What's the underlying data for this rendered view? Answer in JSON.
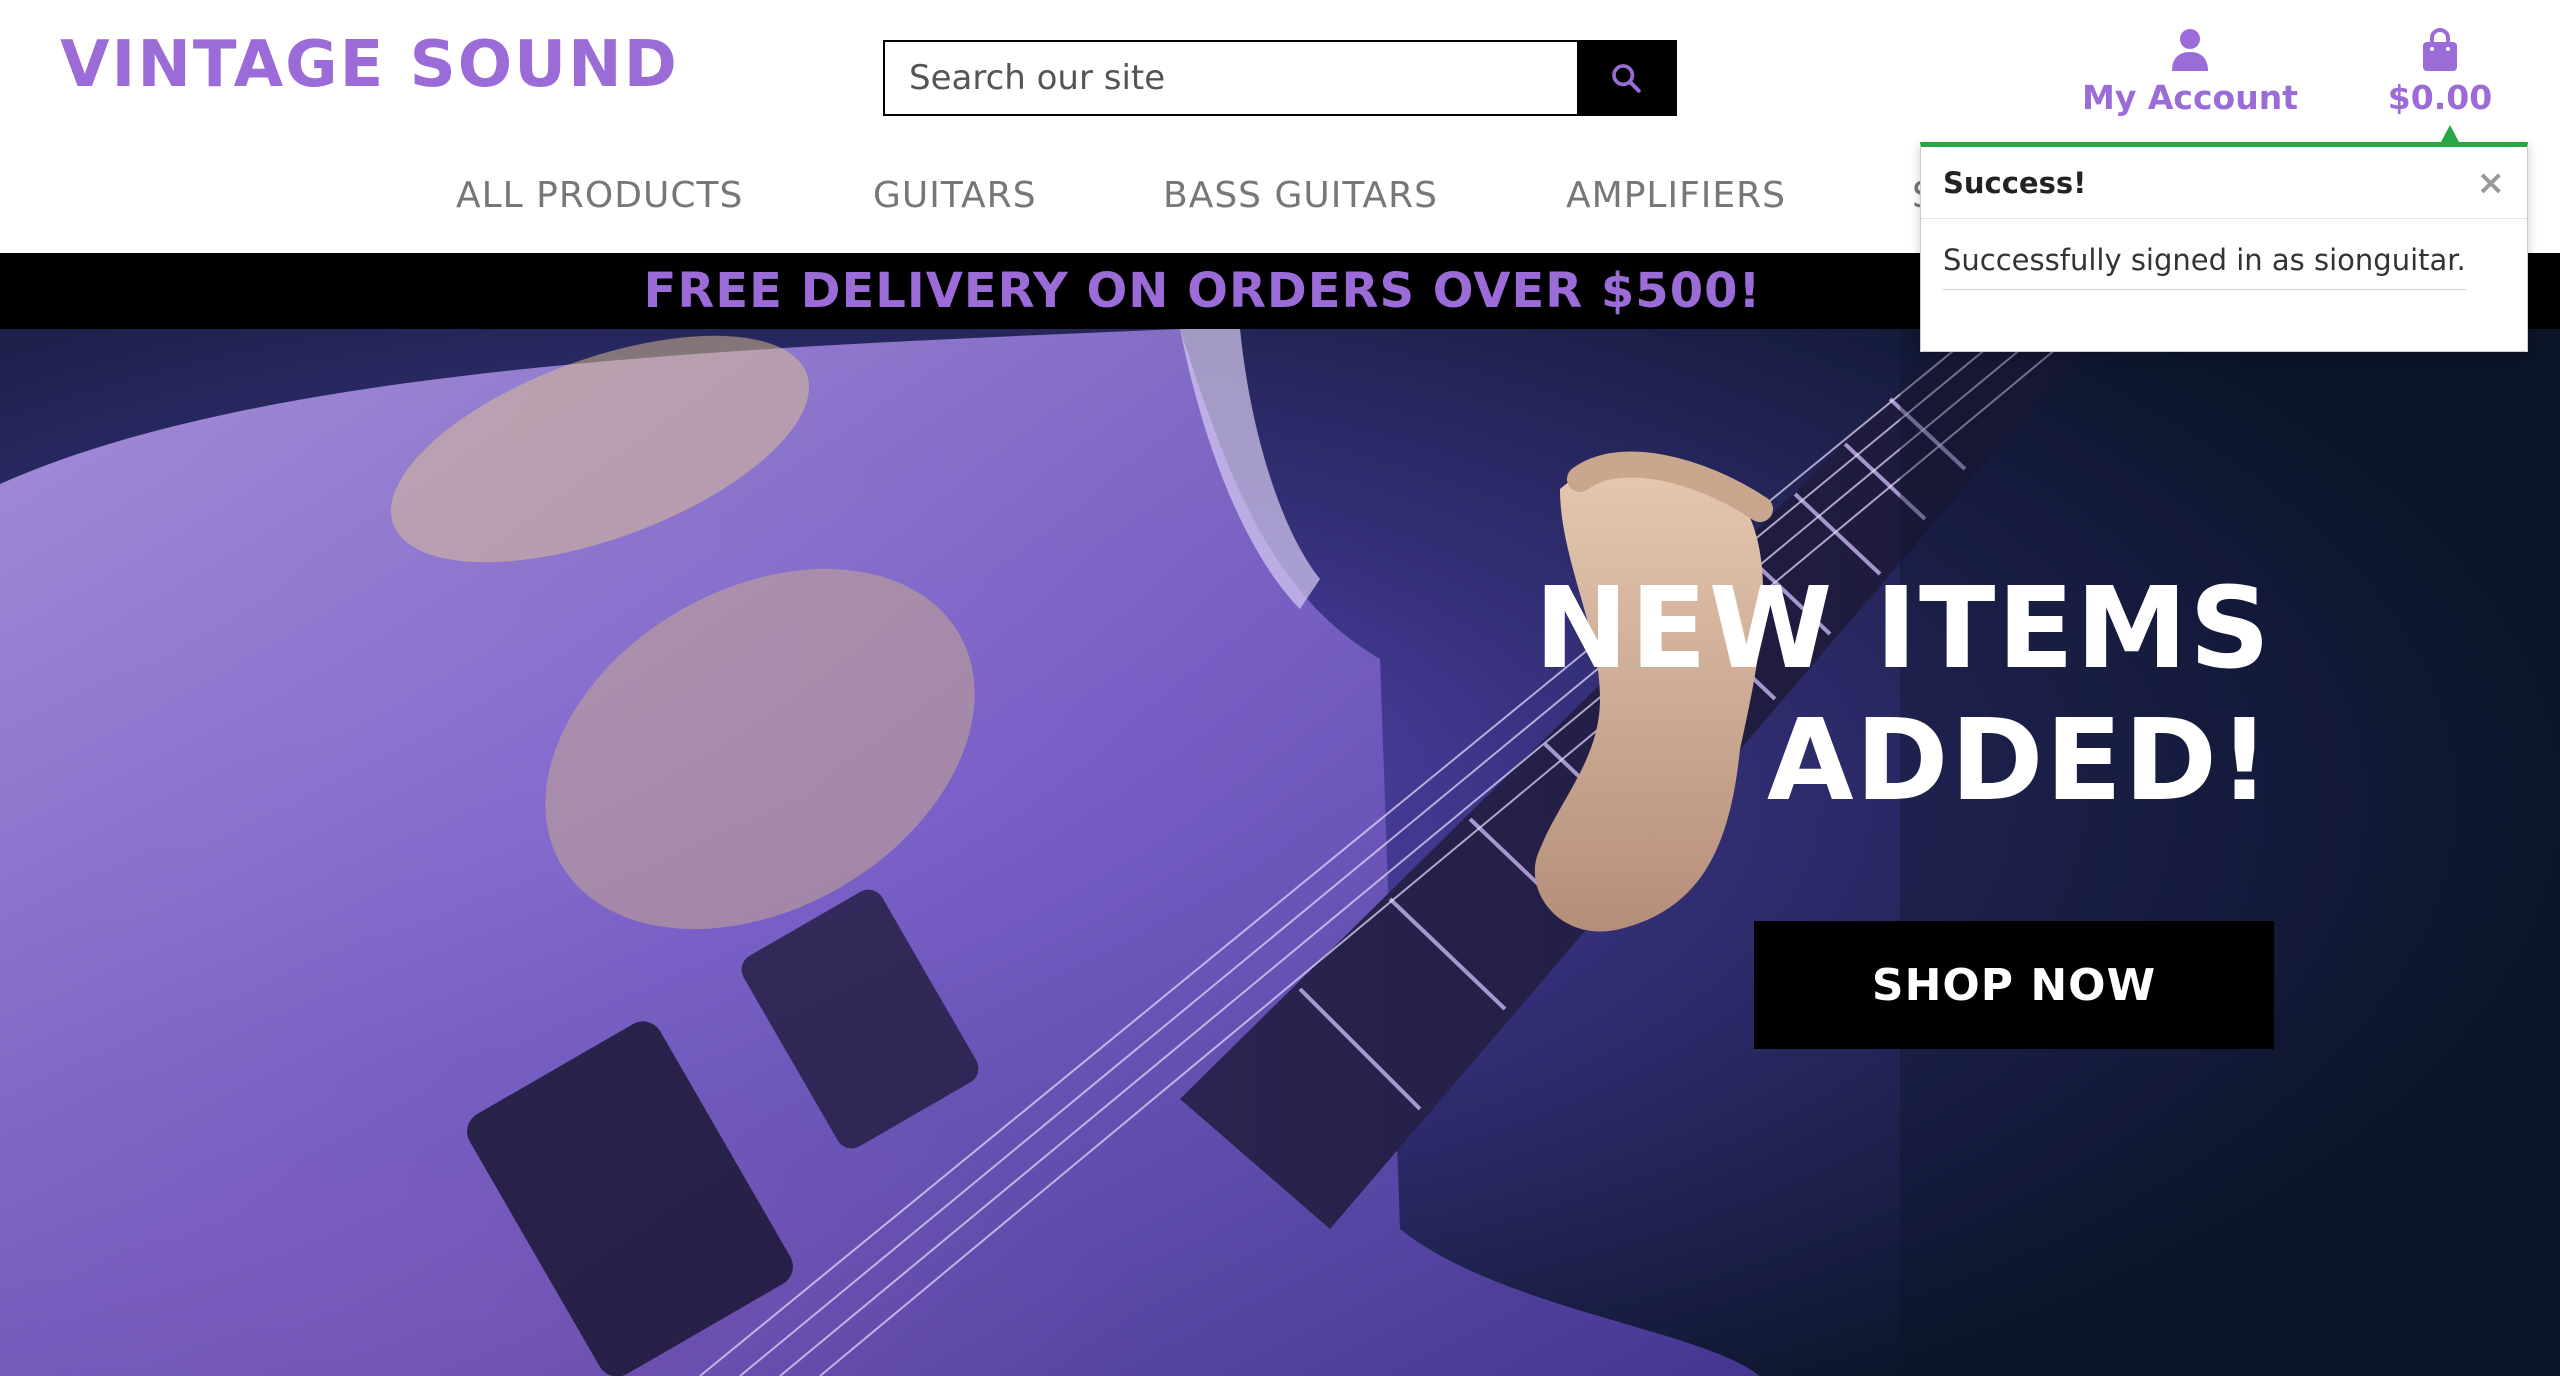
{
  "brand": {
    "name": "VINTAGE SOUND",
    "color": "#9b6cd8"
  },
  "search": {
    "placeholder": "Search our site",
    "icon": "search-icon"
  },
  "account": {
    "label": "My Account",
    "icon": "user-icon"
  },
  "bag": {
    "total": "$0.00",
    "icon": "shopping-bag-icon"
  },
  "nav": {
    "items": [
      {
        "label": "ALL PRODUCTS"
      },
      {
        "label": "GUITARS"
      },
      {
        "label": "BASS GUITARS"
      },
      {
        "label": "AMPLIFIERS"
      },
      {
        "label": "S"
      }
    ]
  },
  "banner": {
    "text": "FREE DELIVERY ON ORDERS OVER $500!"
  },
  "hero": {
    "title_line1": "NEW ITEMS",
    "title_line2": "ADDED!",
    "cta": "SHOP NOW"
  },
  "toast": {
    "title": "Success!",
    "close": "×",
    "message": "Successfully signed in as sionguitar.",
    "accent": "#28a745"
  }
}
